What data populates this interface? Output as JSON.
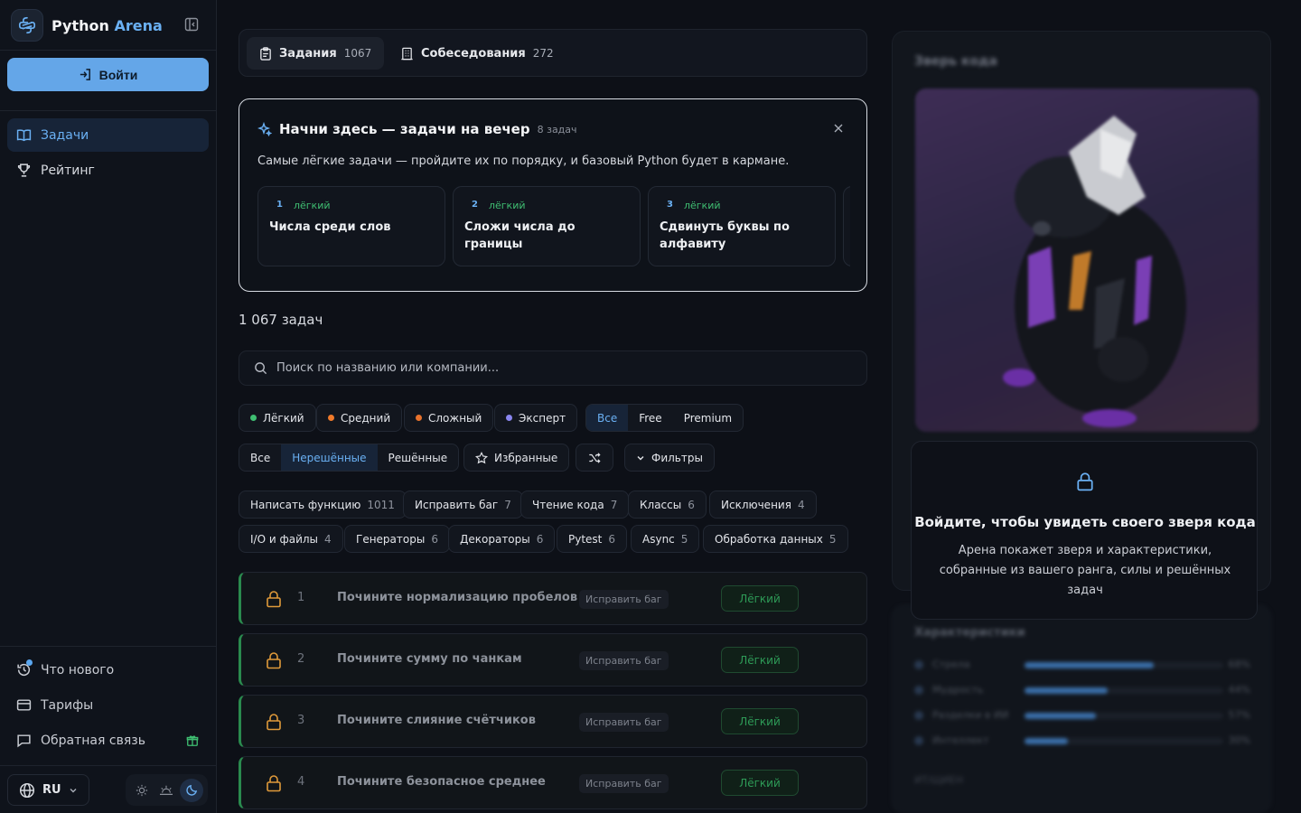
{
  "brand": {
    "name_part1": "Python",
    "name_part2": "Arena"
  },
  "sidebar": {
    "login_label": "Войти",
    "nav": [
      {
        "label": "Задачи",
        "active": true
      },
      {
        "label": "Рейтинг",
        "active": false
      }
    ],
    "bottom": [
      {
        "label": "Что нового"
      },
      {
        "label": "Тарифы"
      },
      {
        "label": "Обратная связь"
      }
    ],
    "language": "RU"
  },
  "tabs": [
    {
      "label": "Задания",
      "count": "1067",
      "active": true
    },
    {
      "label": "Собеседования",
      "count": "272",
      "active": false
    }
  ],
  "start": {
    "title": "Начни здесь — задачи на вечер",
    "subtitle": "8 задач",
    "description": "Самые лёгкие задачи — пройдите их по порядку, и базовый Python будет в кармане.",
    "cards": [
      {
        "num": "1",
        "level": "лёгкий",
        "name": "Числа среди слов"
      },
      {
        "num": "2",
        "level": "лёгкий",
        "name": "Сложи числа до границы"
      },
      {
        "num": "3",
        "level": "лёгкий",
        "name": "Сдвинуть буквы по алфавиту"
      }
    ]
  },
  "total": "1 067 задач",
  "search": {
    "placeholder": "Поиск по названию или компании..."
  },
  "difficulty": [
    {
      "label": "Лёгкий",
      "color": "#3fbf72"
    },
    {
      "label": "Средний",
      "color": "#f07a2a"
    },
    {
      "label": "Сложный",
      "color": "#e8722c"
    },
    {
      "label": "Эксперт",
      "color": "#8a86f0"
    }
  ],
  "access": [
    "Все",
    "Free",
    "Premium"
  ],
  "status": [
    "Все",
    "Нерешённые",
    "Решённые"
  ],
  "favorites_label": "Избранные",
  "filters_label": "Фильтры",
  "categories": [
    {
      "label": "Написать функцию",
      "count": "1011"
    },
    {
      "label": "Исправить баг",
      "count": "7"
    },
    {
      "label": "Чтение кода",
      "count": "7"
    },
    {
      "label": "Классы",
      "count": "6"
    },
    {
      "label": "Исключения",
      "count": "4"
    },
    {
      "label": "I/O и файлы",
      "count": "4"
    },
    {
      "label": "Генераторы",
      "count": "6"
    },
    {
      "label": "Декораторы",
      "count": "6"
    },
    {
      "label": "Pytest",
      "count": "6"
    },
    {
      "label": "Async",
      "count": "5"
    },
    {
      "label": "Обработка данных",
      "count": "5"
    }
  ],
  "tasks": [
    {
      "idx": "1",
      "title": "Почините нормализацию пробелов",
      "tag": "Исправить баг",
      "level": "Лёгкий"
    },
    {
      "idx": "2",
      "title": "Почините сумму по чанкам",
      "tag": "Исправить баг",
      "level": "Лёгкий"
    },
    {
      "idx": "3",
      "title": "Почините слияние счётчиков",
      "tag": "Исправить баг",
      "level": "Лёгкий"
    },
    {
      "idx": "4",
      "title": "Почините безопасное среднее",
      "tag": "Исправить баг",
      "level": "Лёгкий"
    }
  ],
  "right": {
    "title": "Зверь кода",
    "login_title": "Войдите, чтобы увидеть своего зверя кода",
    "login_desc": "Арена покажет зверя и характеристики, собранные из вашего ранга, силы и решённых задач",
    "stats_title": "Характеристики",
    "stats": [
      {
        "name": "Стрела",
        "value": "68%",
        "fraction": 0.65
      },
      {
        "name": "Мудрость",
        "value": "44%",
        "fraction": 0.42
      },
      {
        "name": "Разделки в ИИ",
        "value": "57%",
        "fraction": 0.36
      },
      {
        "name": "Интеллект",
        "value": "30%",
        "fraction": 0.22
      }
    ],
    "footer": "ИТ/ЩИЕН"
  }
}
